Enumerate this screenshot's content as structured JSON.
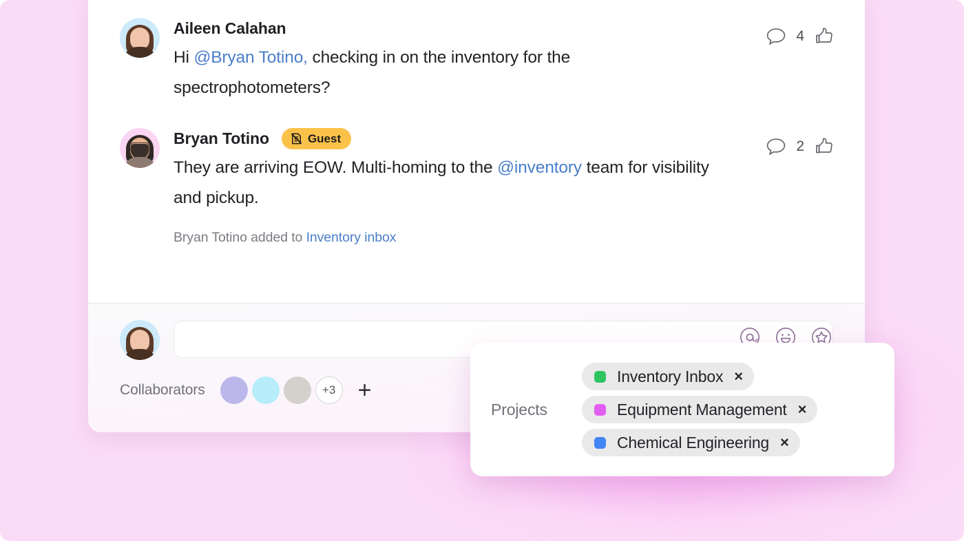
{
  "theme": {
    "page_background": "#fbdcf7",
    "card_background": "#ffffff",
    "glow_color": "#f78cf0",
    "mention_color": "#4a7ec9",
    "guest_badge_color": "#fbc24a"
  },
  "thread": {
    "messages": [
      {
        "author": "Aileen Calahan",
        "avatar_name": "avatar-aileen-calahan",
        "badge": null,
        "text_parts": [
          {
            "text": "Hi ",
            "type": "plain"
          },
          {
            "text": "@Bryan Totino,",
            "type": "mention"
          },
          {
            "text": " checking in on the inventory for the spectrophotometers?",
            "type": "plain"
          }
        ],
        "comment_count": "4",
        "system_line": null
      },
      {
        "author": "Bryan Totino",
        "avatar_name": "avatar-bryan-totino",
        "badge": {
          "label": "Guest",
          "icon": "guest-pass-icon"
        },
        "text_parts": [
          {
            "text": "They are arriving EOW. Multi-homing to the ",
            "type": "plain"
          },
          {
            "text": "@inventory",
            "type": "mention"
          },
          {
            "text": " team for visibility and pickup.",
            "type": "plain"
          }
        ],
        "comment_count": "2",
        "system_line": {
          "prefix": "Bryan Totino added to ",
          "link": "Inventory inbox"
        }
      }
    ],
    "action_icons": {
      "comment": "comment-bubble-icon",
      "like": "thumbs-up-icon"
    }
  },
  "composer": {
    "avatar_name": "avatar-current-user",
    "input_value": "",
    "input_placeholder": "",
    "tools": [
      {
        "name": "mention-icon",
        "glyph": "@"
      },
      {
        "name": "emoji-icon",
        "glyph": "smiley"
      },
      {
        "name": "star-icon",
        "glyph": "star"
      }
    ]
  },
  "collaborators": {
    "label": "Collaborators",
    "avatars": [
      {
        "name": "collaborator-avatar-1",
        "color": "#bcb7ea"
      },
      {
        "name": "collaborator-avatar-2",
        "color": "#b7edfa"
      },
      {
        "name": "collaborator-avatar-3",
        "color": "#d4d0cc"
      }
    ],
    "overflow_label": "+3",
    "add_label": "+"
  },
  "projects_popup": {
    "label": "Projects",
    "chips": [
      {
        "label": "Inventory Inbox",
        "color": "#2ec45f",
        "close_label": "×"
      },
      {
        "label": "Equipment Management",
        "color": "#e05ef0",
        "close_label": "×"
      },
      {
        "label": "Chemical Engineering",
        "color": "#4285f4",
        "close_label": "×"
      }
    ]
  }
}
